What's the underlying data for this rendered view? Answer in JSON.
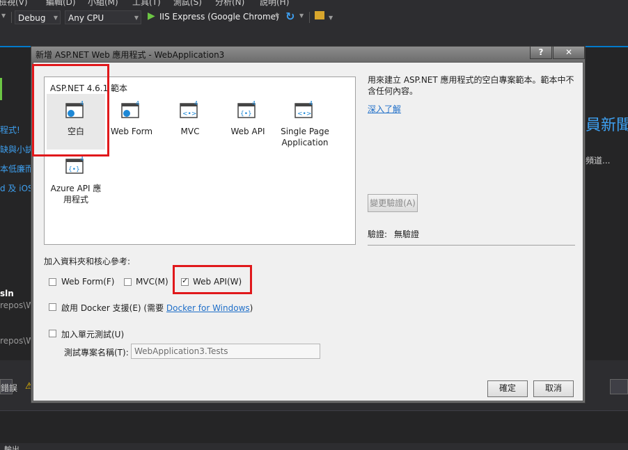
{
  "vs": {
    "menu": [
      "檢視(V)",
      "編輯(D)",
      "小組(M)",
      "工具(T)",
      "測試(S)",
      "分析(N)",
      "說明(H)"
    ],
    "toolbar": {
      "config": "Debug",
      "platform": "Any CPU",
      "run_target": "IIS Express (Google Chrome)"
    },
    "background": {
      "links": [
        "程式!",
        "缺與小訣",
        "本低廉而",
        "d 及 iOS"
      ],
      "news_title": "員新聞",
      "channel": "頻道...",
      "project_name": "sln",
      "paths": [
        "repos\\W",
        "repos\\W"
      ],
      "error_tab": "錯誤",
      "output_tab": "輸出"
    }
  },
  "dialog": {
    "title": "新增 ASP.NET Web 應用程式 - WebApplication3",
    "help_label": "?",
    "close_label": "✕",
    "templates_header": "ASP.NET 4.6.1 範本",
    "templates": [
      {
        "label": "空白",
        "selected": true
      },
      {
        "label": "Web Form",
        "selected": false
      },
      {
        "label": "MVC",
        "selected": false
      },
      {
        "label": "Web API",
        "selected": false
      },
      {
        "label": "Single Page Application",
        "selected": false
      },
      {
        "label": "Azure API 應用程式",
        "selected": false
      }
    ],
    "description": "用來建立 ASP.NET 應用程式的空白專案範本。範本中不含任何內容。",
    "learn_more": "深入了解",
    "change_auth": "變更驗證(A)",
    "auth_label": "驗證:",
    "auth_value": "無驗證",
    "folders_label": "加入資料夾和核心參考:",
    "folder_options": [
      {
        "label": "Web Form(F)",
        "checked": false
      },
      {
        "label": "MVC(M)",
        "checked": false
      },
      {
        "label": "Web API(W)",
        "checked": true
      }
    ],
    "docker_label": "啟用 Docker 支援(E) (需要",
    "docker_link": "Docker for Windows",
    "docker_suffix": ")",
    "docker_checked": false,
    "unit_test_label": "加入單元測試(U)",
    "unit_test_checked": false,
    "test_project_label": "測試專案名稱(T):",
    "test_project_value": "WebApplication3.Tests",
    "ok": "確定",
    "cancel": "取消"
  }
}
